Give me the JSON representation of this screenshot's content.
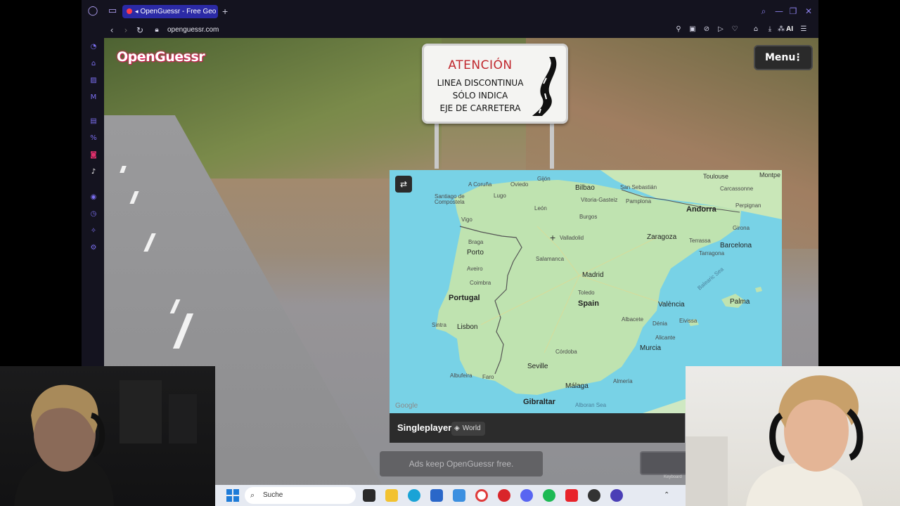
{
  "browser": {
    "tab_title": "OpenGuessr - Free Geo",
    "url": "openguessr.com",
    "ai_label": "AI"
  },
  "game": {
    "logo": "OpenGuessr",
    "menu_label": "Menu",
    "mode_label": "Singleplayer",
    "map_badge": "World",
    "ads_text": "Ads keep OpenGuessr free.",
    "keyboard_hint": "Keyboard"
  },
  "streetview_sign": {
    "title": "ATENCIÓN",
    "line1": "LINEA DISCONTINUA",
    "line2": "SÓLO INDICA",
    "line3": "EJE DE CARRETERA"
  },
  "map": {
    "attribution": "Google",
    "countries": [
      "Portugal",
      "Spain",
      "Andorra",
      "Gibraltar"
    ],
    "cities": {
      "toulouse": "Toulouse",
      "montpellier": "Montpe",
      "carcassonne": "Carcassonne",
      "perpignan": "Perpignan",
      "a_coruna": "A Coruña",
      "oviedo": "Oviedo",
      "gijon": "Gijón",
      "bilbao": "Bilbao",
      "san_sebastian": "San Sebastián",
      "santiago": "Santiago de Compostela",
      "lugo": "Lugo",
      "vitoria": "Vitoria-Gasteiz",
      "pamplona": "Pamplona",
      "leon": "León",
      "burgos": "Burgos",
      "vigo": "Vigo",
      "girona": "Girona",
      "valladolid": "Valladolid",
      "zaragoza": "Zaragoza",
      "terrassa": "Terrassa",
      "barcelona": "Barcelona",
      "tarragona": "Tarragona",
      "braga": "Braga",
      "porto": "Porto",
      "salamanca": "Salamanca",
      "aveiro": "Aveiro",
      "madrid": "Madrid",
      "coimbra": "Coimbra",
      "toledo": "Toledo",
      "valencia": "València",
      "palma": "Palma",
      "sintra": "Sintra",
      "lisbon": "Lisbon",
      "albacete": "Albacete",
      "denia": "Dénia",
      "eivissa": "Eivissa",
      "alicante": "Alicante",
      "cordoba": "Córdoba",
      "murcia": "Murcia",
      "seville": "Seville",
      "albufeira": "Albufeira",
      "faro": "Faro",
      "malaga": "Málaga",
      "almeria": "Almería",
      "alboran": "Alboran Sea",
      "balearic": "Balearic Sea"
    }
  },
  "taskbar": {
    "search_placeholder": "Suche"
  },
  "colors": {
    "accent": "#2b2aa6",
    "sea": "#78d2e6",
    "land": "#bfe3b0",
    "logo": "#e0245e"
  }
}
